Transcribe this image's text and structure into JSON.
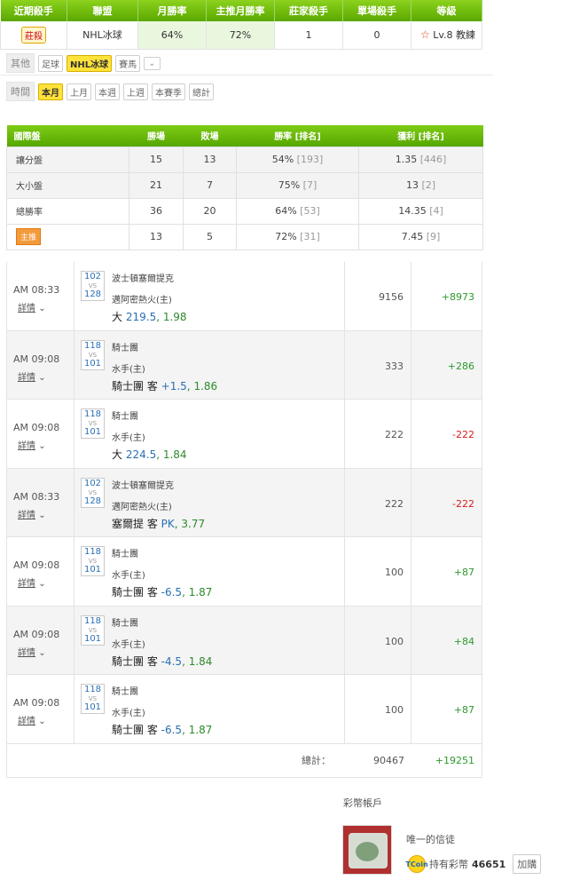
{
  "top_stats": {
    "headers": [
      "近期殺手",
      "聯盟",
      "月勝率",
      "主推月勝率",
      "莊家殺手",
      "單場殺手",
      "等級"
    ],
    "badge": "莊殺",
    "league": "NHL冰球",
    "month_rate": "64%",
    "main_month_rate": "72%",
    "banker_killer": "1",
    "single_killer": "0",
    "level": "Lv.8 教練"
  },
  "other_filter": {
    "label": "其他",
    "options": [
      "足球",
      "NHL冰球",
      "賽馬"
    ],
    "active": "NHL冰球",
    "dropdown": "⌄"
  },
  "time_filter": {
    "label": "時間",
    "options": [
      "本月",
      "上月",
      "本週",
      "上週",
      "本賽季",
      "總計"
    ],
    "active": "本月"
  },
  "summary": {
    "headers": [
      "國際盤",
      "勝場",
      "敗場",
      "勝率 [排名]",
      "獲利 [排名]"
    ],
    "rows": [
      {
        "name": "讓分盤",
        "win": "15",
        "lose": "13",
        "rate": "54%",
        "rate_rank": "[193]",
        "profit": "1.35",
        "profit_rank": "[446]"
      },
      {
        "name": "大小盤",
        "win": "21",
        "lose": "7",
        "rate": "75%",
        "rate_rank": "[7]",
        "profit": "13",
        "profit_rank": "[2]"
      },
      {
        "name": "總勝率",
        "win": "36",
        "lose": "20",
        "rate": "64%",
        "rate_rank": "[53]",
        "profit": "14.35",
        "profit_rank": "[4]"
      },
      {
        "name": "主推",
        "win": "13",
        "lose": "5",
        "rate": "72%",
        "rate_rank": "[31]",
        "profit": "7.45",
        "profit_rank": "[9]"
      }
    ]
  },
  "bets": [
    {
      "time": "AM 08:33",
      "detail": "詳情",
      "s1": "102",
      "s2": "128",
      "team1": "波士頓塞爾提克",
      "team2": "邁阿密熱火(主)",
      "pick": "大",
      "line": "219.5",
      "odds": "1.98",
      "amount": "9156",
      "profit": "+8973",
      "result": "pos"
    },
    {
      "time": "AM 09:08",
      "detail": "詳情",
      "s1": "118",
      "s2": "101",
      "team1": "騎士團",
      "team2": "水手(主)",
      "pick": "騎士團 客",
      "line": "+1.5",
      "odds": "1.86",
      "amount": "333",
      "profit": "+286",
      "result": "pos"
    },
    {
      "time": "AM 09:08",
      "detail": "詳情",
      "s1": "118",
      "s2": "101",
      "team1": "騎士團",
      "team2": "水手(主)",
      "pick": "大",
      "line": "224.5",
      "odds": "1.84",
      "amount": "222",
      "profit": "-222",
      "result": "neg"
    },
    {
      "time": "AM 08:33",
      "detail": "詳情",
      "s1": "102",
      "s2": "128",
      "team1": "波士頓塞爾提克",
      "team2": "邁阿密熱火(主)",
      "pick": "塞爾提 客",
      "line": "PK",
      "odds": "3.77",
      "amount": "222",
      "profit": "-222",
      "result": "neg"
    },
    {
      "time": "AM 09:08",
      "detail": "詳情",
      "s1": "118",
      "s2": "101",
      "team1": "騎士團",
      "team2": "水手(主)",
      "pick": "騎士團 客",
      "line": "-6.5",
      "odds": "1.87",
      "amount": "100",
      "profit": "+87",
      "result": "pos"
    },
    {
      "time": "AM 09:08",
      "detail": "詳情",
      "s1": "118",
      "s2": "101",
      "team1": "騎士團",
      "team2": "水手(主)",
      "pick": "騎士團 客",
      "line": "-4.5",
      "odds": "1.84",
      "amount": "100",
      "profit": "+84",
      "result": "pos"
    },
    {
      "time": "AM 09:08",
      "detail": "詳情",
      "s1": "118",
      "s2": "101",
      "team1": "騎士團",
      "team2": "水手(主)",
      "pick": "騎士團 客",
      "line": "-6.5",
      "odds": "1.87",
      "amount": "100",
      "profit": "+87",
      "result": "pos"
    }
  ],
  "total": {
    "label": "總計：",
    "amount": "90467",
    "profit": "+19251"
  },
  "account": {
    "title": "彩幣帳戶",
    "username": "唯一的信徒",
    "coin_label": "持有彩幣",
    "coin_amount": "46651",
    "buy_label": "加購",
    "coin_icon_text": "TCoin"
  },
  "colors": {
    "accent_green": "#5aa800",
    "profit_positive": "#2c9a2c",
    "profit_negative": "#d62020",
    "line_blue": "#2a6fb4"
  }
}
